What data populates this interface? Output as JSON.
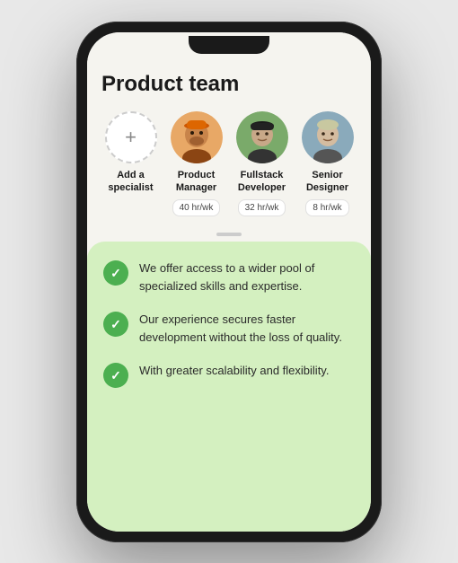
{
  "phone": {
    "team": {
      "title": "Product team",
      "members": [
        {
          "id": "add",
          "label": "Add a\nspecialist",
          "type": "add"
        },
        {
          "id": "pm",
          "label": "Product\nManager",
          "rate": "40 hr/wk",
          "type": "person",
          "skin": "warm"
        },
        {
          "id": "fd",
          "label": "Fullstack\nDeveloper",
          "rate": "32 hr/wk",
          "type": "person",
          "skin": "olive"
        },
        {
          "id": "sd",
          "label": "Senior\nDesigner",
          "rate": "8 hr/wk",
          "type": "person",
          "skin": "light"
        }
      ]
    },
    "benefits": [
      "We offer access to a wider pool of specialized skills and expertise.",
      "Our experience secures faster development without the loss of quality.",
      "With greater scalability and flexibility."
    ]
  },
  "icons": {
    "plus": "+",
    "check": "✓"
  }
}
